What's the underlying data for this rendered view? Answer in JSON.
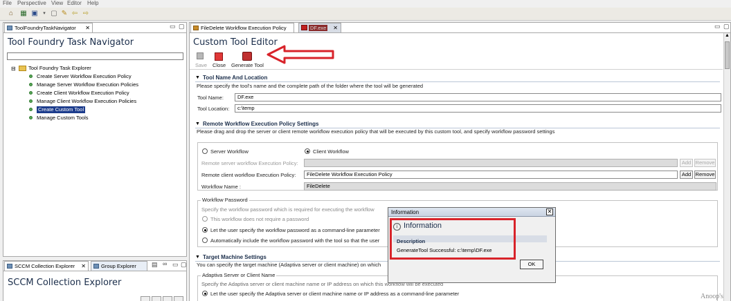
{
  "menu": [
    "File",
    "Perspective",
    "View",
    "Editor",
    "Help"
  ],
  "navigator": {
    "tab_label": "ToolFoundryTaskNavigator",
    "title": "Tool Foundry Task Navigator",
    "root": "Tool Foundry Task Explorer",
    "items": [
      "Create Server Workflow Execution Policy",
      "Manage Server Workflow Execution Policies",
      "Create Client Workflow Execution Policy",
      "Manage Client Workflow Execution Policies",
      "Create Custom Tool",
      "Manage Custom Tools"
    ],
    "selected_index": 4
  },
  "bottom_panel": {
    "tab1": "SCCM Collection Explorer",
    "tab2": "Group Explorer",
    "title": "SCCM Collection Explorer"
  },
  "editor": {
    "tab1": "FileDelete Workflow Execution Policy",
    "tab2": "DF.exe",
    "title": "Custom Tool Editor",
    "toolbar": {
      "save": "Save",
      "close": "Close",
      "generate": "Generate Tool"
    },
    "section1": {
      "title": "Tool Name And Location",
      "desc": "Please specify the tool's name and the complete path of the folder where the tool will be generated",
      "name_label": "Tool Name:",
      "name_value": "DF.exe",
      "location_label": "Tool Location:",
      "location_value": "c:\\temp"
    },
    "section2": {
      "title": "Remote Workflow Execution Policy Settings",
      "desc": "Please drag and drop the server or client remote workflow execution policy that will be executed by this custom tool, and specify workflow password settings",
      "server_radio": "Server Workflow",
      "client_radio": "Client Workflow",
      "server_policy_label": "Remote server workflow Execution Policy:",
      "client_policy_label": "Remote client workflow Execution Policy:",
      "client_policy_value": "FileDelete Workflow Execution Policy",
      "workflow_name_label": "Workflow Name :",
      "workflow_name_value": "FileDelete",
      "add": "Add",
      "remove": "Remove",
      "password_group": "Workflow Password",
      "password_desc": "Specify the workflow password which is required for executing the workflow",
      "opt1": "This workflow does not require a password",
      "opt2": "Let the user specify the workflow password as a command-line parameter",
      "opt3": "Automatically include the workflow password with the tool so that the user"
    },
    "section3": {
      "title": "Target Machine Settings",
      "desc": "You can specify the target machine (Adaptiva server or client machine) on which",
      "group": "Adaptiva Server or Client Name",
      "group_desc": "Specify the Adaptiva server or client machine name or IP address on which this workflow will be executed",
      "opt1": "Let the user specify the Adaptiva server or client machine name or IP address as a command-line parameter"
    }
  },
  "dialog": {
    "titlebar": "Information",
    "heading": "Information",
    "desc_label": "Description",
    "message": "GenerateTool Successful: c:\\temp\\DF.exe",
    "ok": "OK"
  },
  "watermark": "Anoop's",
  "colors": {
    "annotation": "#d8232a",
    "selection": "#1c3c8c",
    "title": "#1a2d4a"
  }
}
